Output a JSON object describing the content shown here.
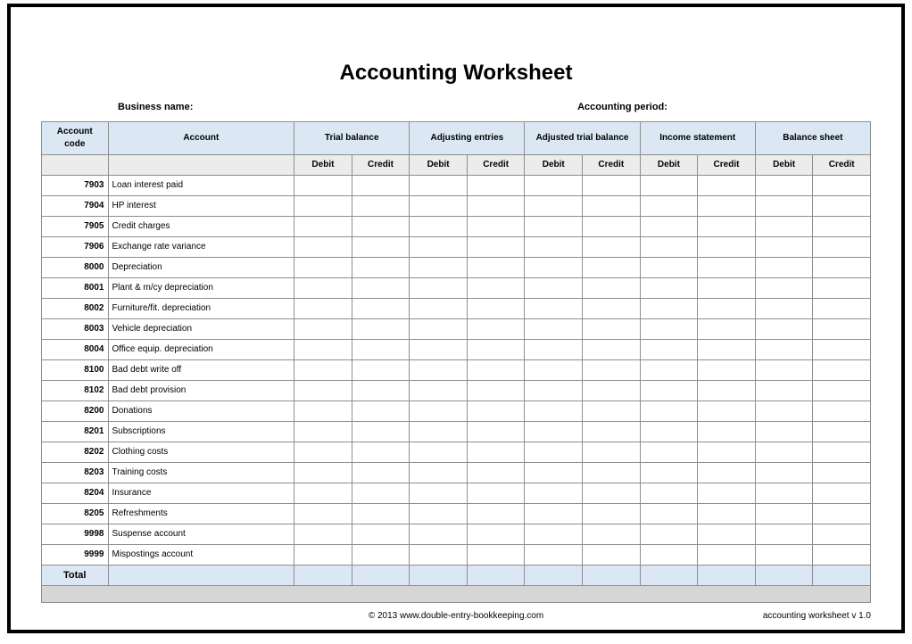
{
  "title": "Accounting Worksheet",
  "meta": {
    "business_name_label": "Business name:",
    "accounting_period_label": "Accounting period:"
  },
  "headers": {
    "account_code": "Account code",
    "account": "Account",
    "groups": [
      "Trial balance",
      "Adjusting entries",
      "Adjusted trial balance",
      "Income statement",
      "Balance sheet"
    ],
    "debit": "Debit",
    "credit": "Credit"
  },
  "rows": [
    {
      "code": "7903",
      "account": "Loan interest paid"
    },
    {
      "code": "7904",
      "account": "HP interest"
    },
    {
      "code": "7905",
      "account": "Credit charges"
    },
    {
      "code": "7906",
      "account": "Exchange rate variance"
    },
    {
      "code": "8000",
      "account": "Depreciation"
    },
    {
      "code": "8001",
      "account": "Plant & m/cy depreciation"
    },
    {
      "code": "8002",
      "account": "Furniture/fit. depreciation"
    },
    {
      "code": "8003",
      "account": "Vehicle depreciation"
    },
    {
      "code": "8004",
      "account": "Office equip. depreciation"
    },
    {
      "code": "8100",
      "account": "Bad debt write off"
    },
    {
      "code": "8102",
      "account": "Bad debt provision"
    },
    {
      "code": "8200",
      "account": "Donations"
    },
    {
      "code": "8201",
      "account": "Subscriptions"
    },
    {
      "code": "8202",
      "account": "Clothing costs"
    },
    {
      "code": "8203",
      "account": "Training costs"
    },
    {
      "code": "8204",
      "account": "Insurance"
    },
    {
      "code": "8205",
      "account": "Refreshments"
    },
    {
      "code": "9998",
      "account": "Suspense account"
    },
    {
      "code": "9999",
      "account": "Mispostings account"
    }
  ],
  "total_label": "Total",
  "footer": {
    "copyright": "© 2013 www.double-entry-bookkeeping.com",
    "version": "accounting worksheet v 1.0"
  }
}
